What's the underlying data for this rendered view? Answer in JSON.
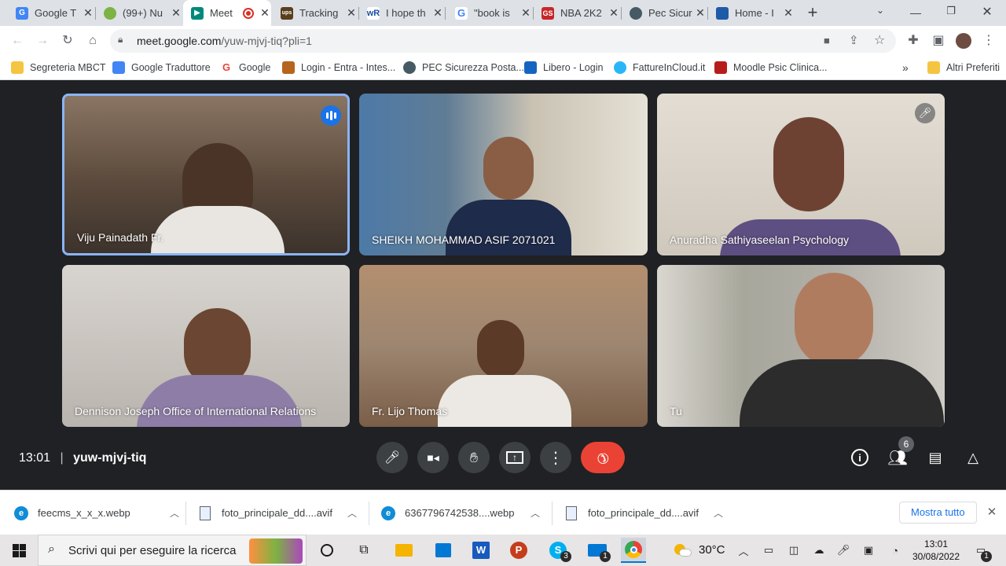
{
  "browser": {
    "tabs": [
      {
        "title": "Google T",
        "icon": "google-translate-icon",
        "color": "#4285f4"
      },
      {
        "title": "(99+) Nu",
        "icon": "leaf-icon",
        "color": "#7cb342"
      },
      {
        "title": "Meet",
        "icon": "google-meet-icon",
        "color": "#00897b",
        "active": true
      },
      {
        "title": "Tracking",
        "icon": "ups-icon",
        "color": "#5a3e1b"
      },
      {
        "title": "I hope th",
        "icon": "wordreference-icon",
        "color": "#1a4fa0"
      },
      {
        "title": "\"book is",
        "icon": "google-icon",
        "color": "#4285f4"
      },
      {
        "title": "NBA 2K2",
        "icon": "gamestop-icon",
        "color": "#c62828"
      },
      {
        "title": "Pec Sicur",
        "icon": "pec-icon",
        "color": "#455a64"
      },
      {
        "title": "Home - I",
        "icon": "site-icon",
        "color": "#1e5aa8"
      }
    ],
    "url_host": "meet.google.com",
    "url_path": "/yuw-mjvj-tiq?pli=1",
    "bookmarks": [
      {
        "label": "Segreteria MBCT",
        "color": "#f5c542"
      },
      {
        "label": "Google Traduttore",
        "color": "#4285f4"
      },
      {
        "label": "Google",
        "color": "#ea4335"
      },
      {
        "label": "Login - Entra - Intes...",
        "color": "#b5651d"
      },
      {
        "label": "PEC Sicurezza Posta...",
        "color": "#455a64"
      },
      {
        "label": "Libero - Login",
        "color": "#1565c0"
      },
      {
        "label": "FattureInCloud.it",
        "color": "#29b6f6"
      },
      {
        "label": "Moodle Psic Clinica...",
        "color": "#b71c1c"
      }
    ],
    "bookmarks_more": "»",
    "other_bookmarks": "Altri Preferiti"
  },
  "meet": {
    "participants": [
      {
        "name": "Viju Painadath Fr.",
        "bg": "#6d5a4a",
        "speaking": true
      },
      {
        "name": "SHEIKH MOHAMMAD ASIF 2071021",
        "bg": "#5a6470"
      },
      {
        "name": "Anuradha Sathiyaseelan Psychology",
        "bg": "#b9b2a8",
        "muted": true
      },
      {
        "name": "Dennison Joseph Office of International Relations",
        "bg": "#8e8a86"
      },
      {
        "name": "Fr. Lijo Thomas",
        "bg": "#7d6e62"
      },
      {
        "name": "Tu",
        "bg": "#8d9189"
      }
    ],
    "time": "13:01",
    "separator": "|",
    "meeting_code": "yuw-mjvj-tiq",
    "people_count": "6"
  },
  "downloads": {
    "items": [
      "feecms_x_x_x.webp",
      "foto_principale_dd....avif",
      "6367796742538....webp",
      "foto_principale_dd....avif"
    ],
    "show_all": "Mostra tutto"
  },
  "taskbar": {
    "search_placeholder": "Scrivi qui per eseguire la ricerca",
    "weather": "30°C",
    "clock_time": "13:01",
    "clock_date": "30/08/2022",
    "skype_badge": "3",
    "mail_badge": "1",
    "notif_badge": "1"
  }
}
